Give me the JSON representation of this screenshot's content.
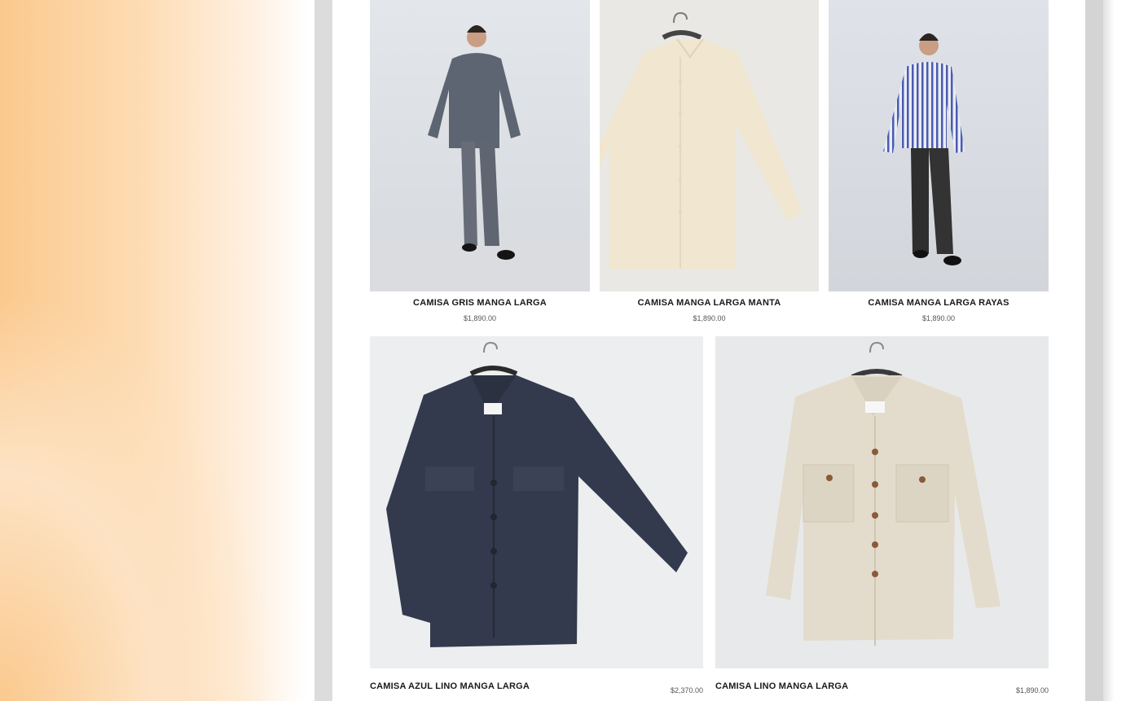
{
  "products_row1": [
    {
      "title": "CAMISA GRIS MANGA LARGA",
      "price": "$1,890.00",
      "image": "model-grey-shirt-photo"
    },
    {
      "title": "CAMISA MANGA LARGA MANTA",
      "price": "$1,890.00",
      "image": "cream-shirt-on-hanger-photo"
    },
    {
      "title": "CAMISA MANGA LARGA RAYAS",
      "price": "$1,890.00",
      "image": "model-striped-shirt-photo"
    }
  ],
  "products_row2": [
    {
      "title": "CAMISA AZUL LINO MANGA LARGA",
      "price": "$2,370.00",
      "image": "navy-linen-shirt-photo"
    },
    {
      "title": "CAMISA LINO MANGA LARGA",
      "price": "$1,890.00",
      "image": "beige-linen-shirt-photo"
    }
  ],
  "colors": {
    "page_bg": "#ffffff",
    "frame": "#dcdcdc",
    "accent_gradient": "#fbc98e",
    "title_text": "#1a1a1a",
    "price_text": "#555555"
  }
}
